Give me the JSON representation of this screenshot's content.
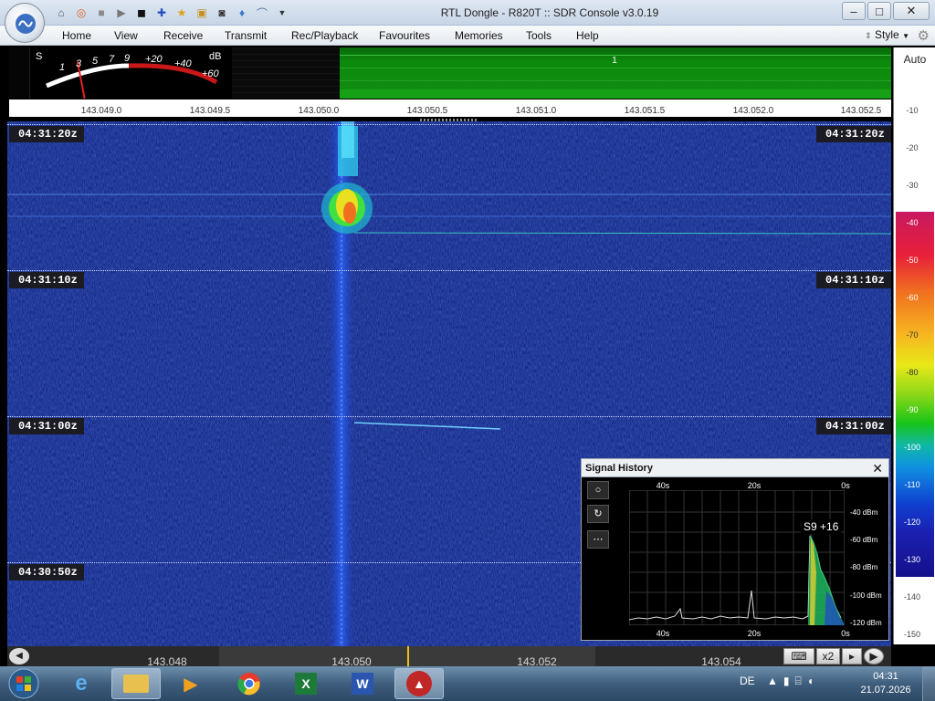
{
  "window": {
    "title": "RTL Dongle - R820T :: SDR Console v3.0.19"
  },
  "menu": {
    "items": [
      "Home",
      "View",
      "Receive",
      "Transmit",
      "Rec/Playback",
      "Favourites",
      "Memories",
      "Tools",
      "Help"
    ],
    "style_label": "Style"
  },
  "smeter": {
    "s_label": "S",
    "db_label": "dB",
    "scale": [
      "1",
      "3",
      "5",
      "7",
      "9",
      "+20",
      "+40",
      "+60"
    ]
  },
  "spectrum": {
    "marker": "1"
  },
  "freq_scale": [
    "143.049.0",
    "143.049.5",
    "143.050.0",
    "143.050.5",
    "143.051.0",
    "143.051.5",
    "143.052.0",
    "143.052.5"
  ],
  "waterfall": {
    "times": [
      "04:31:20z",
      "04:31:10z",
      "04:31:00z",
      "04:30:50z"
    ]
  },
  "db_scale": {
    "auto_label": "Auto",
    "ticks": [
      "-10",
      "-20",
      "-30",
      "-40",
      "-50",
      "-60",
      "-70",
      "-80",
      "-90",
      "-100",
      "-110",
      "-120",
      "-130",
      "-140",
      "-150"
    ]
  },
  "bottom_scale": {
    "labels": [
      "143.048",
      "143.050",
      "143.052",
      "143.054"
    ],
    "zoom": "x2"
  },
  "signal_history": {
    "title": "Signal History",
    "x_labels": [
      "40s",
      "20s",
      "0s"
    ],
    "y_labels": [
      "-40 dBm",
      "-60 dBm",
      "-80 dBm",
      "-100 dBm",
      "-120 dBm"
    ],
    "reading": "S9 +16"
  },
  "taskbar": {
    "lang": "DE",
    "time": "04:31",
    "date": "21.07.2026"
  },
  "colors": {
    "spectrum_green": "#118e11",
    "waterfall_bg": "#0a1a6e",
    "signal_fill": "#1fb860"
  }
}
